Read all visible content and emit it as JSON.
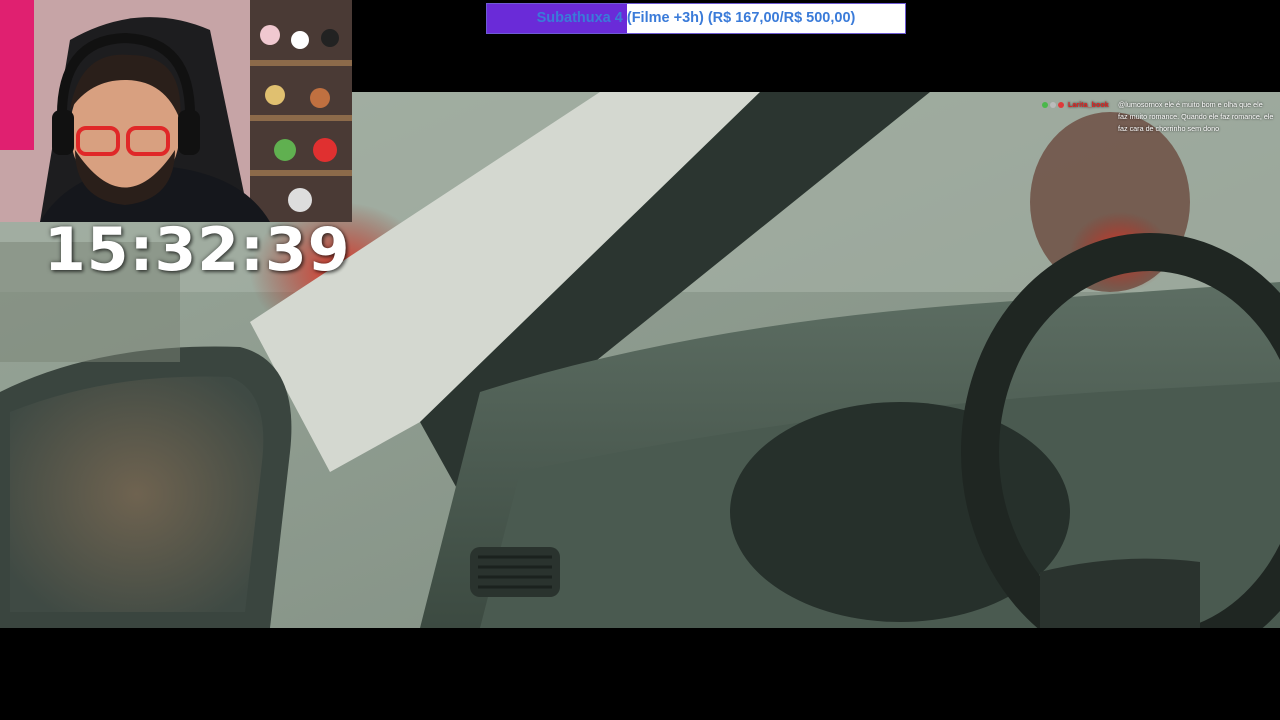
{
  "stream": {
    "timer": "15:32:39",
    "subathon": {
      "label": "Subathuxa 4 (Filme +3h) (R$ 167,00/R$ 500,00)",
      "progress_fraction": 0.334,
      "fill_color": "#6a2bd8",
      "text_color": "#3a7bd9"
    },
    "chat": {
      "username": "Larita_book",
      "message": "@lumosornox ele é muito bom e olha que ele faz muito romance. Quando ele faz romance, ele faz cara de chorrinho sem dono",
      "badges": [
        "pencil-icon",
        "skull-icon",
        "heart-icon"
      ]
    }
  }
}
